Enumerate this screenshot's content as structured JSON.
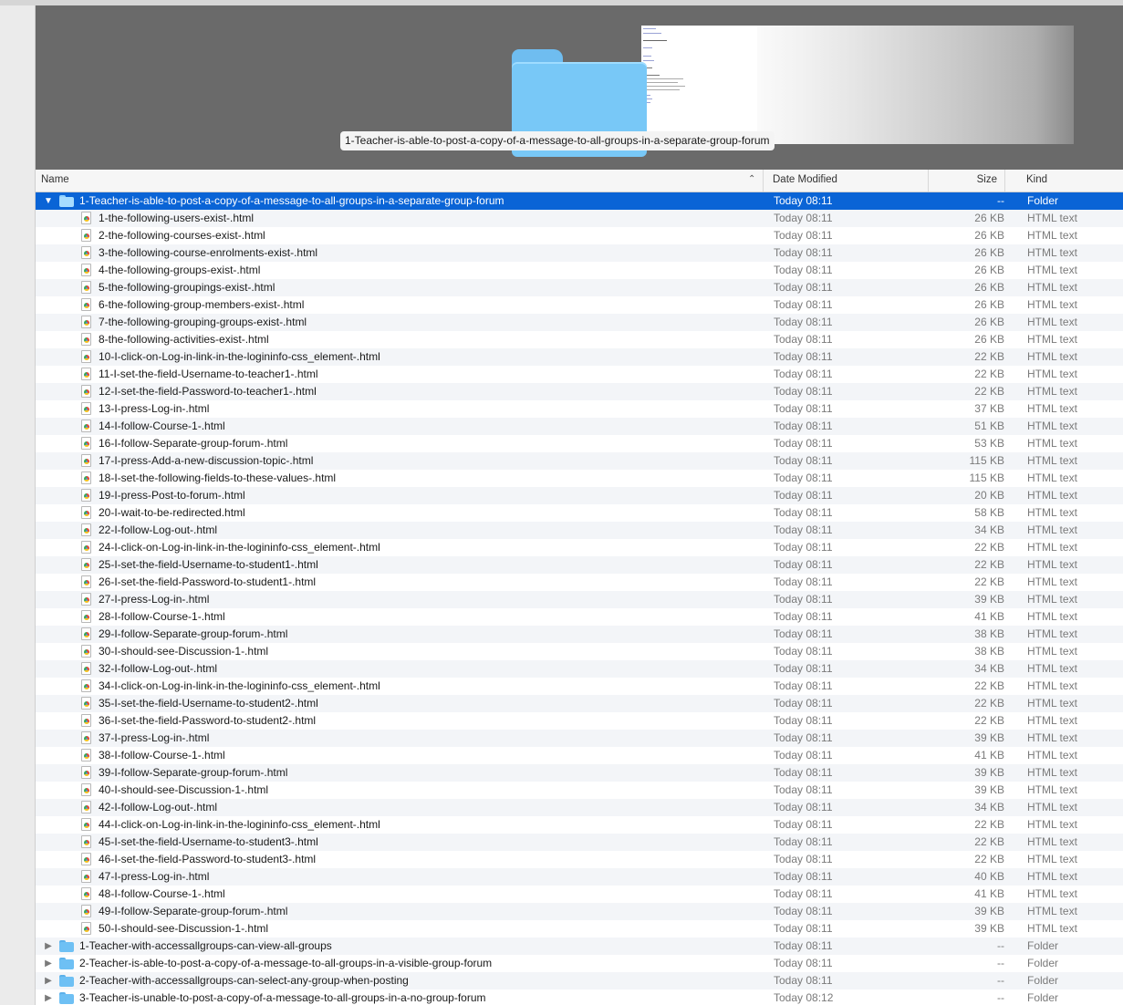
{
  "preview": {
    "caption": "1-Teacher-is-able-to-post-a-copy-of-a-message-to-all-groups-in-a-separate-group-forum"
  },
  "columns": {
    "name": "Name",
    "date": "Date Modified",
    "size": "Size",
    "kind": "Kind"
  },
  "selected_folder": {
    "name": "1-Teacher-is-able-to-post-a-copy-of-a-message-to-all-groups-in-a-separate-group-forum",
    "date": "Today 08:11",
    "size": "--",
    "kind": "Folder"
  },
  "files": [
    {
      "name": "1-the-following-users-exist-.html",
      "date": "Today 08:11",
      "size": "26 KB",
      "kind": "HTML text"
    },
    {
      "name": "2-the-following-courses-exist-.html",
      "date": "Today 08:11",
      "size": "26 KB",
      "kind": "HTML text"
    },
    {
      "name": "3-the-following-course-enrolments-exist-.html",
      "date": "Today 08:11",
      "size": "26 KB",
      "kind": "HTML text"
    },
    {
      "name": "4-the-following-groups-exist-.html",
      "date": "Today 08:11",
      "size": "26 KB",
      "kind": "HTML text"
    },
    {
      "name": "5-the-following-groupings-exist-.html",
      "date": "Today 08:11",
      "size": "26 KB",
      "kind": "HTML text"
    },
    {
      "name": "6-the-following-group-members-exist-.html",
      "date": "Today 08:11",
      "size": "26 KB",
      "kind": "HTML text"
    },
    {
      "name": "7-the-following-grouping-groups-exist-.html",
      "date": "Today 08:11",
      "size": "26 KB",
      "kind": "HTML text"
    },
    {
      "name": "8-the-following-activities-exist-.html",
      "date": "Today 08:11",
      "size": "26 KB",
      "kind": "HTML text"
    },
    {
      "name": "10-I-click-on-Log-in-link-in-the-logininfo-css_element-.html",
      "date": "Today 08:11",
      "size": "22 KB",
      "kind": "HTML text"
    },
    {
      "name": "11-I-set-the-field-Username-to-teacher1-.html",
      "date": "Today 08:11",
      "size": "22 KB",
      "kind": "HTML text"
    },
    {
      "name": "12-I-set-the-field-Password-to-teacher1-.html",
      "date": "Today 08:11",
      "size": "22 KB",
      "kind": "HTML text"
    },
    {
      "name": "13-I-press-Log-in-.html",
      "date": "Today 08:11",
      "size": "37 KB",
      "kind": "HTML text"
    },
    {
      "name": "14-I-follow-Course-1-.html",
      "date": "Today 08:11",
      "size": "51 KB",
      "kind": "HTML text"
    },
    {
      "name": "16-I-follow-Separate-group-forum-.html",
      "date": "Today 08:11",
      "size": "53 KB",
      "kind": "HTML text"
    },
    {
      "name": "17-I-press-Add-a-new-discussion-topic-.html",
      "date": "Today 08:11",
      "size": "115 KB",
      "kind": "HTML text"
    },
    {
      "name": "18-I-set-the-following-fields-to-these-values-.html",
      "date": "Today 08:11",
      "size": "115 KB",
      "kind": "HTML text"
    },
    {
      "name": "19-I-press-Post-to-forum-.html",
      "date": "Today 08:11",
      "size": "20 KB",
      "kind": "HTML text"
    },
    {
      "name": "20-I-wait-to-be-redirected.html",
      "date": "Today 08:11",
      "size": "58 KB",
      "kind": "HTML text"
    },
    {
      "name": "22-I-follow-Log-out-.html",
      "date": "Today 08:11",
      "size": "34 KB",
      "kind": "HTML text"
    },
    {
      "name": "24-I-click-on-Log-in-link-in-the-logininfo-css_element-.html",
      "date": "Today 08:11",
      "size": "22 KB",
      "kind": "HTML text"
    },
    {
      "name": "25-I-set-the-field-Username-to-student1-.html",
      "date": "Today 08:11",
      "size": "22 KB",
      "kind": "HTML text"
    },
    {
      "name": "26-I-set-the-field-Password-to-student1-.html",
      "date": "Today 08:11",
      "size": "22 KB",
      "kind": "HTML text"
    },
    {
      "name": "27-I-press-Log-in-.html",
      "date": "Today 08:11",
      "size": "39 KB",
      "kind": "HTML text"
    },
    {
      "name": "28-I-follow-Course-1-.html",
      "date": "Today 08:11",
      "size": "41 KB",
      "kind": "HTML text"
    },
    {
      "name": "29-I-follow-Separate-group-forum-.html",
      "date": "Today 08:11",
      "size": "38 KB",
      "kind": "HTML text"
    },
    {
      "name": "30-I-should-see-Discussion-1-.html",
      "date": "Today 08:11",
      "size": "38 KB",
      "kind": "HTML text"
    },
    {
      "name": "32-I-follow-Log-out-.html",
      "date": "Today 08:11",
      "size": "34 KB",
      "kind": "HTML text"
    },
    {
      "name": "34-I-click-on-Log-in-link-in-the-logininfo-css_element-.html",
      "date": "Today 08:11",
      "size": "22 KB",
      "kind": "HTML text"
    },
    {
      "name": "35-I-set-the-field-Username-to-student2-.html",
      "date": "Today 08:11",
      "size": "22 KB",
      "kind": "HTML text"
    },
    {
      "name": "36-I-set-the-field-Password-to-student2-.html",
      "date": "Today 08:11",
      "size": "22 KB",
      "kind": "HTML text"
    },
    {
      "name": "37-I-press-Log-in-.html",
      "date": "Today 08:11",
      "size": "39 KB",
      "kind": "HTML text"
    },
    {
      "name": "38-I-follow-Course-1-.html",
      "date": "Today 08:11",
      "size": "41 KB",
      "kind": "HTML text"
    },
    {
      "name": "39-I-follow-Separate-group-forum-.html",
      "date": "Today 08:11",
      "size": "39 KB",
      "kind": "HTML text"
    },
    {
      "name": "40-I-should-see-Discussion-1-.html",
      "date": "Today 08:11",
      "size": "39 KB",
      "kind": "HTML text"
    },
    {
      "name": "42-I-follow-Log-out-.html",
      "date": "Today 08:11",
      "size": "34 KB",
      "kind": "HTML text"
    },
    {
      "name": "44-I-click-on-Log-in-link-in-the-logininfo-css_element-.html",
      "date": "Today 08:11",
      "size": "22 KB",
      "kind": "HTML text"
    },
    {
      "name": "45-I-set-the-field-Username-to-student3-.html",
      "date": "Today 08:11",
      "size": "22 KB",
      "kind": "HTML text"
    },
    {
      "name": "46-I-set-the-field-Password-to-student3-.html",
      "date": "Today 08:11",
      "size": "22 KB",
      "kind": "HTML text"
    },
    {
      "name": "47-I-press-Log-in-.html",
      "date": "Today 08:11",
      "size": "40 KB",
      "kind": "HTML text"
    },
    {
      "name": "48-I-follow-Course-1-.html",
      "date": "Today 08:11",
      "size": "41 KB",
      "kind": "HTML text"
    },
    {
      "name": "49-I-follow-Separate-group-forum-.html",
      "date": "Today 08:11",
      "size": "39 KB",
      "kind": "HTML text"
    },
    {
      "name": "50-I-should-see-Discussion-1-.html",
      "date": "Today 08:11",
      "size": "39 KB",
      "kind": "HTML text"
    }
  ],
  "other_folders": [
    {
      "name": "1-Teacher-with-accessallgroups-can-view-all-groups",
      "date": "Today 08:11",
      "size": "--",
      "kind": "Folder"
    },
    {
      "name": "2-Teacher-is-able-to-post-a-copy-of-a-message-to-all-groups-in-a-visible-group-forum",
      "date": "Today 08:11",
      "size": "--",
      "kind": "Folder"
    },
    {
      "name": "2-Teacher-with-accessallgroups-can-select-any-group-when-posting",
      "date": "Today 08:11",
      "size": "--",
      "kind": "Folder"
    },
    {
      "name": "3-Teacher-is-unable-to-post-a-copy-of-a-message-to-all-groups-in-a-no-group-forum",
      "date": "Today 08:12",
      "size": "--",
      "kind": "Folder"
    }
  ],
  "icons": {
    "expanded": "disclosure-expanded-icon",
    "collapsed": "disclosure-collapsed-icon",
    "folder": "folder-icon",
    "html": "html-file-icon",
    "sort": "sort-ascending-icon"
  }
}
